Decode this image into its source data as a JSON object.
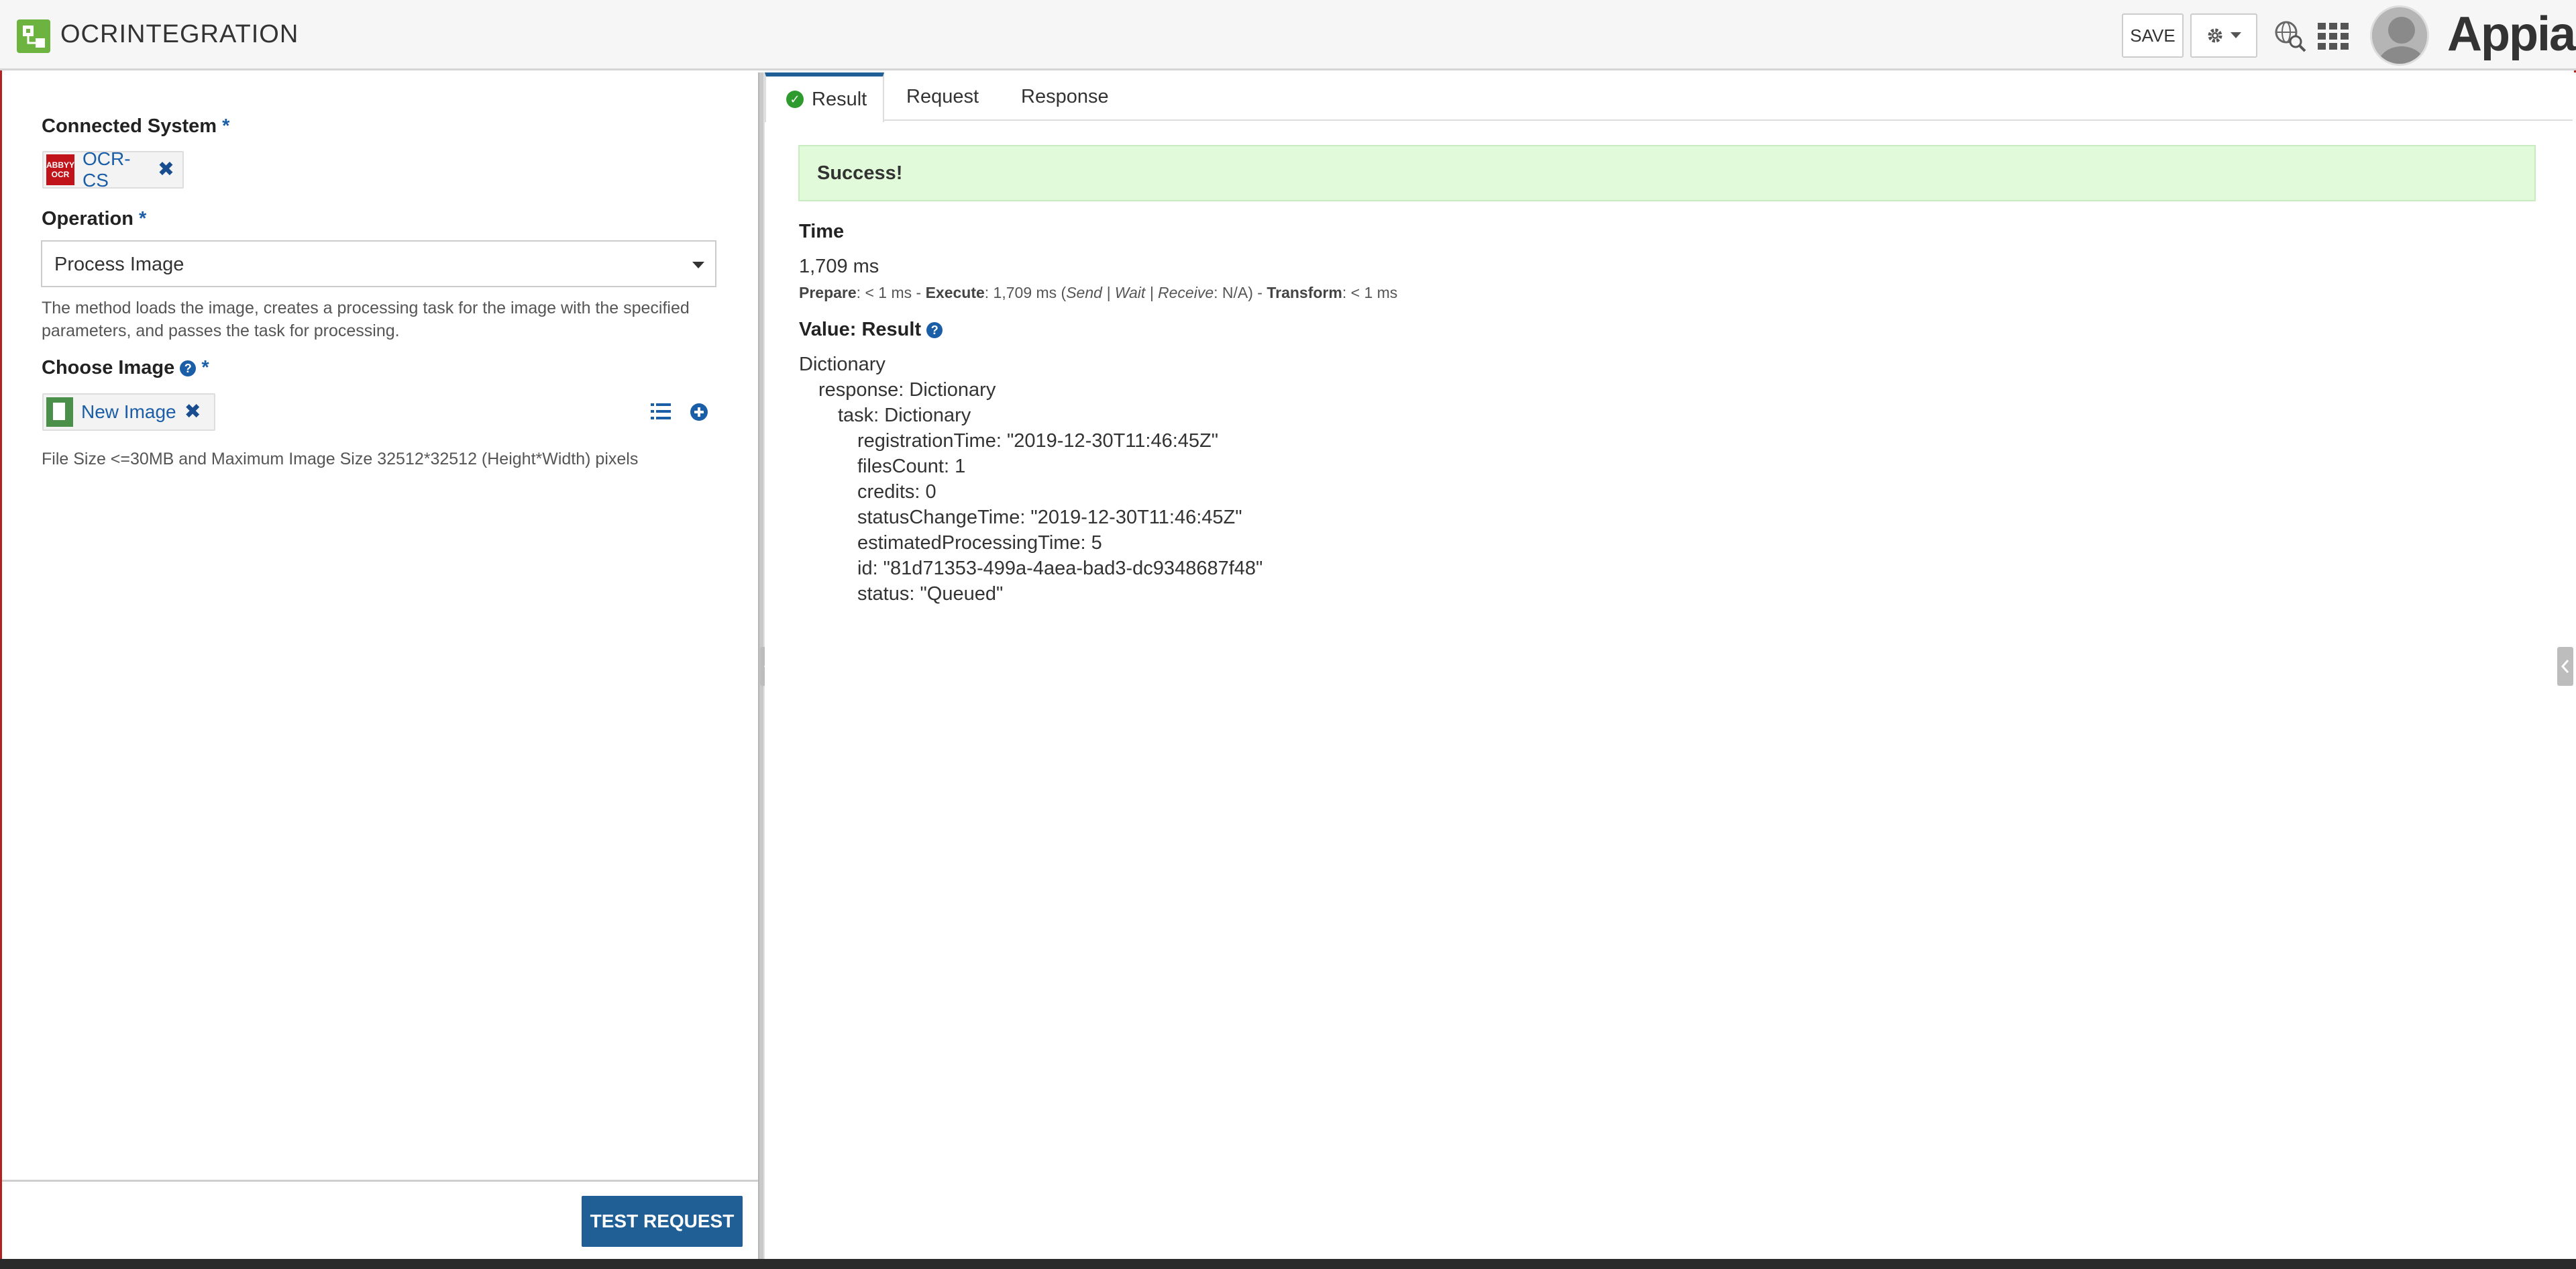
{
  "header": {
    "title": "OCRINTEGRATION",
    "save_label": "SAVE",
    "logo_text": "Appian",
    "icons": [
      "integration-app-icon",
      "gear-icon",
      "globe-search-icon",
      "app-grid-icon",
      "user-avatar"
    ]
  },
  "left": {
    "connected_system": {
      "label": "Connected System",
      "required_mark": "*",
      "logo_lines": [
        "ABBYY",
        "OCR"
      ],
      "value": "OCR-CS"
    },
    "operation": {
      "label": "Operation",
      "required_mark": "*",
      "value": "Process Image",
      "instructions": "The method loads the image, creates a processing task for the image with the specified parameters, and passes the task for processing."
    },
    "choose_image": {
      "label": "Choose Image",
      "help_glyph": "?",
      "required_mark": "*",
      "value": "New Image",
      "note": "File Size <=30MB and Maximum Image Size 32512*32512 (Height*Width) pixels"
    },
    "test_request_label": "TEST REQUEST"
  },
  "right": {
    "tabs": [
      {
        "label": "Result",
        "active": true
      },
      {
        "label": "Request",
        "active": false
      },
      {
        "label": "Response",
        "active": false
      }
    ],
    "success_message": "Success!",
    "time": {
      "label": "Time",
      "value": "1,709 ms",
      "prepare_label": "Prepare",
      "prepare_value": ": < 1 ms - ",
      "execute_label": "Execute",
      "execute_value": ": 1,709 ms (",
      "execute_breakdown": "Send | Wait | Receive",
      "execute_breakdown_value": ": N/A) - ",
      "transform_label": "Transform",
      "transform_value": ": < 1 ms"
    },
    "value": {
      "label": "Value: Result",
      "help_glyph": "?",
      "lines": [
        "Dictionary",
        "response: Dictionary",
        "task: Dictionary",
        "registrationTime: \"2019-12-30T11:46:45Z\"",
        "filesCount: 1",
        "credits: 0",
        "statusChangeTime: \"2019-12-30T11:46:45Z\"",
        "estimatedProcessingTime: 5",
        "id: \"81d71353-499a-4aea-bad3-dc9348687f48\"",
        "status: \"Queued\""
      ]
    }
  },
  "colors": {
    "accent": "#1f5f96",
    "success_bg": "#e1fad9",
    "frame": "#b22222",
    "brand_green": "#6db33f"
  }
}
